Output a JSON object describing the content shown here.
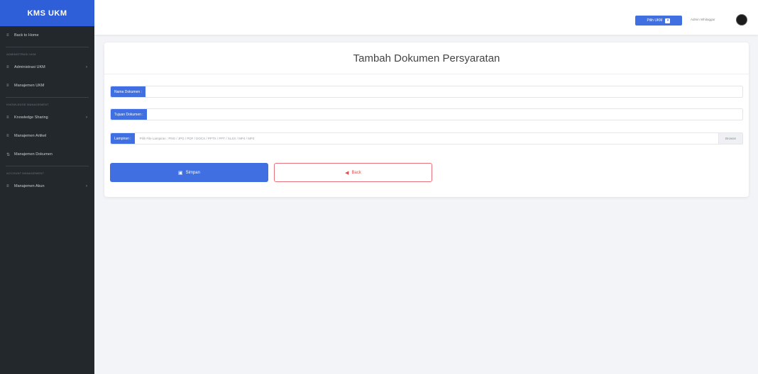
{
  "sidebar": {
    "brand": "KMS UKM",
    "items": [
      {
        "kind": "item",
        "icon": "≡",
        "label": "Back to Home"
      },
      {
        "kind": "divider"
      },
      {
        "kind": "heading",
        "label": "ADMINISTRASI UKM"
      },
      {
        "kind": "item",
        "icon": "≡",
        "label": "Administrasi UKM",
        "chevron": "›"
      },
      {
        "kind": "item",
        "icon": "≡",
        "label": "Manajemen UKM"
      },
      {
        "kind": "divider"
      },
      {
        "kind": "heading",
        "label": "KNOWLEDGE MANAGEMENT"
      },
      {
        "kind": "item",
        "icon": "≡",
        "label": "Knowledge Sharing",
        "chevron": "›"
      },
      {
        "kind": "item",
        "icon": "≡",
        "label": "Manajemen Artikel"
      },
      {
        "kind": "item",
        "icon": "⇅",
        "label": "Manajemen Dokumen"
      },
      {
        "kind": "divider"
      },
      {
        "kind": "heading",
        "label": "ACCOUNT MANAGEMENT"
      },
      {
        "kind": "item",
        "icon": "≡",
        "label": "Manajemen Akun",
        "chevron": "›"
      }
    ]
  },
  "topbar": {
    "pilih_label": "Pilih UKM",
    "user_name": "Admin Whitaggar"
  },
  "form": {
    "title": "Tambah Dokumen Persyaratan",
    "nama_label": "Nama Dokumen :",
    "tujuan_label": "Tujuan Dokumen :",
    "lampiran_label": "Lampiran :",
    "lampiran_placeholder": "Pilih File Lampiran : PNG / JPG / PDF / DOCX / PPTX / PPT / XLSX / MP4 / MP3",
    "browse_label": "Browse",
    "save_label": "Simpan",
    "back_label": "Back"
  },
  "colors": {
    "primary": "#3f6fe0",
    "sidebar_bg": "#23282d",
    "danger": "#d9534f"
  }
}
